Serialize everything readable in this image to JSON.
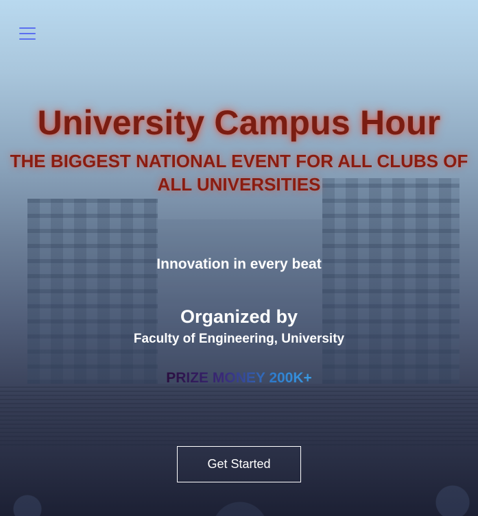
{
  "nav": {
    "menu_icon": "hamburger-menu-icon",
    "menu_color": "#5a6ff0"
  },
  "hero": {
    "title": "University Campus Hour",
    "subtitle": "THE BIGGEST NATIONAL EVENT FOR ALL CLUBS OF ALL UNIVERSITIES",
    "tagline": "Innovation in every beat",
    "organized_heading": "Organized by",
    "organizer": "Faculty of Engineering, University",
    "prize_text": "PRIZE MONEY 200K+",
    "cta_label": "Get Started"
  },
  "colors": {
    "title": "#7a1d12",
    "title_glow": "#eb4628",
    "prize_gradient_start": "#2a0d3e",
    "prize_gradient_end": "#3a9ae2",
    "cta_border": "#ffffff"
  }
}
